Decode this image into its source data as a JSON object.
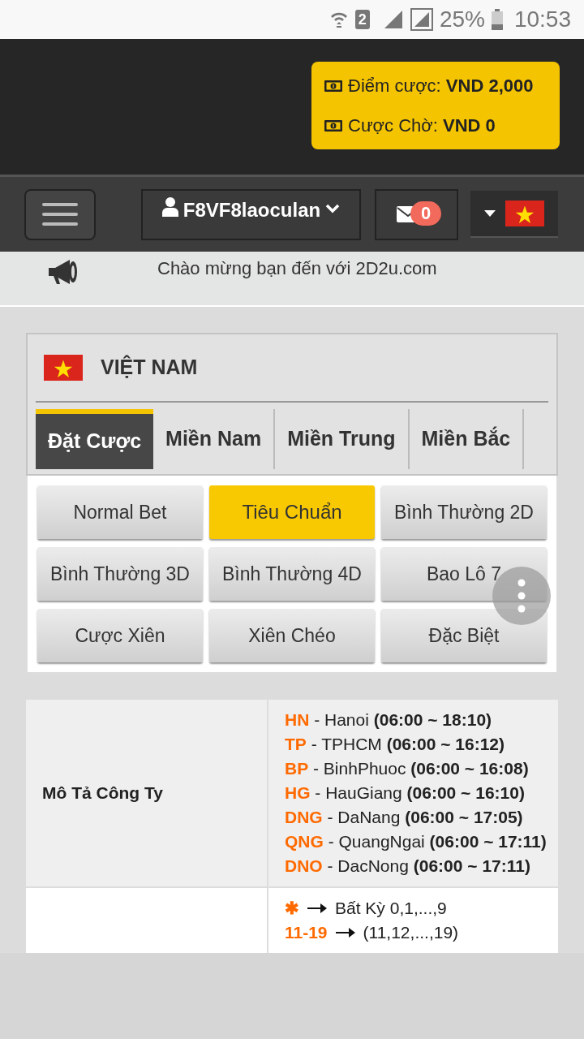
{
  "status_bar": {
    "sim": "2",
    "battery": "25%",
    "time": "10:53"
  },
  "balance": [
    {
      "label": "Điểm cược:",
      "value": "VND 2,000"
    },
    {
      "label": "Cược Chờ:",
      "value": "VND 0"
    }
  ],
  "nav": {
    "username": "F8VF8laoculan",
    "messages": "0"
  },
  "marquee": "Chào mừng bạn đến với 2D2u.com",
  "region": {
    "title": "VIỆT NAM"
  },
  "tabs": [
    {
      "label": "Đặt Cược",
      "selected": true
    },
    {
      "label": "Miền Nam",
      "selected": false
    },
    {
      "label": "Miền Trung",
      "selected": false
    },
    {
      "label": "Miền Bắc",
      "selected": false
    }
  ],
  "bet_types": [
    {
      "label": "Normal Bet",
      "selected": false
    },
    {
      "label": "Tiêu Chuẩn",
      "selected": true
    },
    {
      "label": "Bình Thường 2D",
      "selected": false
    },
    {
      "label": "Bình Thường 3D",
      "selected": false
    },
    {
      "label": "Bình Thường 4D",
      "selected": false
    },
    {
      "label": "Bao Lô 7",
      "selected": false
    },
    {
      "label": "Cược Xiên",
      "selected": false
    },
    {
      "label": "Xiên Chéo",
      "selected": false
    },
    {
      "label": "Đặc Biệt",
      "selected": false
    }
  ],
  "table": {
    "rows": [
      {
        "kind": "companies",
        "label": "Mô Tả Công Ty",
        "items": [
          {
            "code": "HN",
            "name": "- Hanoi",
            "hours": "(06:00 ~ 18:10)"
          },
          {
            "code": "TP",
            "name": "- TPHCM",
            "hours": "(06:00 ~ 16:12)"
          },
          {
            "code": "BP",
            "name": "- BinhPhuoc",
            "hours": "(06:00 ~ 16:08)"
          },
          {
            "code": "HG",
            "name": "- HauGiang",
            "hours": "(06:00 ~ 16:10)"
          },
          {
            "code": "DNG",
            "name": "- DaNang",
            "hours": "(06:00 ~ 17:05)"
          },
          {
            "code": "QNG",
            "name": "- QuangNgai",
            "hours": "(06:00 ~ 17:11)"
          },
          {
            "code": "DNO",
            "name": "- DacNong",
            "hours": "(06:00 ~ 17:11)"
          }
        ]
      },
      {
        "kind": "legend",
        "items": [
          {
            "code": "✱",
            "text": "Bất Kỳ 0,1,...,9"
          },
          {
            "code": "11-19",
            "text": "(11,12,...,19)"
          }
        ]
      }
    ]
  }
}
